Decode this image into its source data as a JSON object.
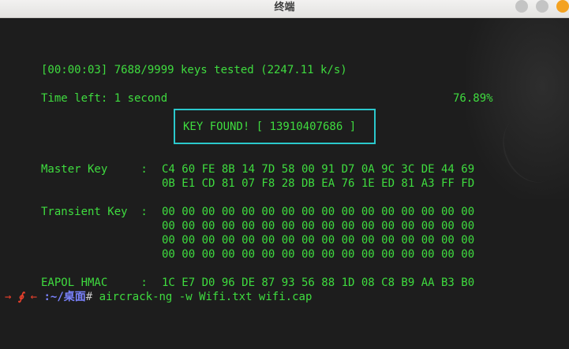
{
  "window": {
    "title": "终端"
  },
  "terminal": {
    "progress_line": "[00:00:03] 7688/9999 keys tested (2247.11 k/s)",
    "time_left": "Time left: 1 second",
    "percent": "76.89%",
    "key_found": "KEY FOUND! [ 13910407686 ]",
    "master_key_label": "Master Key     : ",
    "master_key_rows": [
      "C4 60 FE 8B 14 7D 58 00 91 D7 0A 9C 3C DE 44 69",
      "0B E1 CD 81 07 F8 28 DB EA 76 1E ED 81 A3 FF FD"
    ],
    "transient_key_label": "Transient Key  : ",
    "transient_key_rows": [
      "00 00 00 00 00 00 00 00 00 00 00 00 00 00 00 00",
      "00 00 00 00 00 00 00 00 00 00 00 00 00 00 00 00",
      "00 00 00 00 00 00 00 00 00 00 00 00 00 00 00 00",
      "00 00 00 00 00 00 00 00 00 00 00 00 00 00 00 00"
    ],
    "eapol_label": "EAPOL HMAC     : ",
    "eapol_row": "1C E7 D0 96 DE 87 93 56 88 1D 08 C8 B9 AA B3 B0"
  },
  "prompt": {
    "arrow": "→",
    "symbol": "∮",
    "left_arrow": "←",
    "path": ":~/桌面",
    "hash": "#",
    "command": " aircrack-ng -w Wifi.txt wifi.cap"
  },
  "colors": {
    "text_green": "#3fdc3f",
    "box_cyan": "#2bc8cc",
    "prompt_red": "#e8402c",
    "path_blue": "#7b83ff",
    "close_button": "#f4a221"
  }
}
